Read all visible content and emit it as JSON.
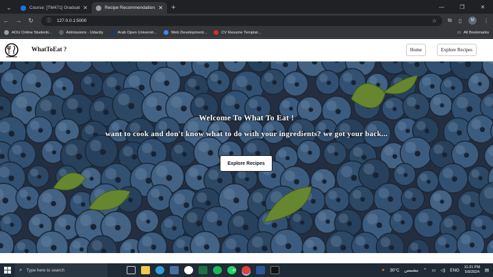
{
  "browser": {
    "tabs": [
      {
        "title": "Course: [TM471] Graduation Pr...",
        "active": false,
        "favicon_color": "#1a73e8"
      },
      {
        "title": "Recipe Recommendation",
        "active": true,
        "favicon_color": "#9aa0a6"
      }
    ],
    "new_tab": "+",
    "url": "127.0.0.1:5000",
    "profile_initial": "M",
    "bookmarks": [
      {
        "label": "AOU Online Studenti...",
        "color": "#9aa0a6"
      },
      {
        "label": "Admissions - Udacity",
        "color": "#5f6368"
      },
      {
        "label": "Arab Open Universit...",
        "color": "#1a3a6b"
      },
      {
        "label": "Web Development...",
        "color": "#4285f4"
      },
      {
        "label": "CV Resume Templat...",
        "color": "#d93025"
      }
    ],
    "all_bookmarks": "All Bookmarks"
  },
  "site": {
    "brand": "WhatToEat ?",
    "nav": {
      "home": "Home",
      "explore": "Explore Recipes"
    },
    "hero": {
      "heading": "Welcome To What To Eat !",
      "tagline": "want to cook and don't know what to do with your ingredients? we got your back...",
      "cta": "Explore Recipes"
    }
  },
  "taskbar": {
    "search_placeholder": "Type here to search",
    "weather": "30°C",
    "weather_desc": "مشمس",
    "language": "ENG",
    "time": "11:21 PM",
    "date": "5/9/2024",
    "badge": "47"
  }
}
